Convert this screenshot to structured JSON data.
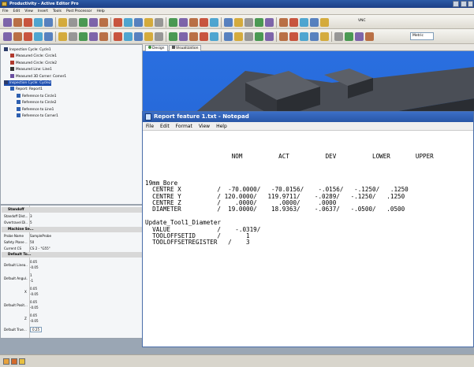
{
  "app": {
    "title": "Productivity - Active Editor Pro"
  },
  "menu": [
    "File",
    "Edit",
    "View",
    "Insert",
    "Tools",
    "Post Processor",
    "Help"
  ],
  "toolbar": {
    "dropdown_label": "Metric",
    "small_label": "VNC"
  },
  "tree": {
    "items": [
      {
        "label": "Inspection Cycle: Cycle1",
        "indent": 0,
        "selected": false,
        "icon_color": "#2c3c6a"
      },
      {
        "label": "Measured Circle: Circle1",
        "indent": 1,
        "selected": false,
        "icon_color": "#b03a2e"
      },
      {
        "label": "Measured Circle: Circle2",
        "indent": 1,
        "selected": false,
        "icon_color": "#b03a2e"
      },
      {
        "label": "Measured Line: Line1",
        "indent": 1,
        "selected": false,
        "icon_color": "#333333"
      },
      {
        "label": "Measured 3D Corner: Corner1",
        "indent": 1,
        "selected": false,
        "icon_color": "#6a4ea0"
      },
      {
        "label": "Inspection Cycle: Cycle2",
        "indent": 0,
        "selected": true,
        "icon_color": "#2c3c6a"
      },
      {
        "label": "Report: Report1",
        "indent": 1,
        "selected": false,
        "icon_color": "#2d5fb0"
      },
      {
        "label": "Reference to Circle1",
        "indent": 2,
        "selected": false,
        "icon_color": "#2d5fb0"
      },
      {
        "label": "Reference to Circle2",
        "indent": 2,
        "selected": false,
        "icon_color": "#2d5fb0"
      },
      {
        "label": "Reference to Line1",
        "indent": 2,
        "selected": false,
        "icon_color": "#2d5fb0"
      },
      {
        "label": "Reference to Corner1",
        "indent": 2,
        "selected": false,
        "icon_color": "#2d5fb0"
      }
    ]
  },
  "props": {
    "groups": [
      {
        "title": "Standoff",
        "rows": [
          {
            "label": "Standoff Dist...",
            "value": "3"
          },
          {
            "label": "Overtravel Di...",
            "value": "5"
          }
        ]
      },
      {
        "title": "Machine Se...",
        "rows": [
          {
            "label": "Probe Name",
            "value": "SampleProbe"
          },
          {
            "label": "Safety Plane ...",
            "value": "50"
          },
          {
            "label": "Current CS",
            "value": "CS 2 - \"G55\""
          }
        ]
      },
      {
        "title": "Default To...",
        "rows": []
      }
    ],
    "tolerance_rows": [
      {
        "label": "Default Linea...",
        "sub": "",
        "values": [
          "0.05",
          "-0.05"
        ]
      },
      {
        "label": "Default Angul...",
        "sub": "",
        "values": [
          "1",
          "-1"
        ]
      },
      {
        "label": "",
        "sub": "X",
        "values": [
          "0.05",
          "-0.05"
        ]
      },
      {
        "label": "Default Posit...Y",
        "sub": "",
        "values": [
          "0.05",
          "-0.05"
        ]
      },
      {
        "label": "",
        "sub": "Z",
        "values": [
          "0.05",
          "-0.05"
        ]
      }
    ],
    "last_row": {
      "label": "Default True...",
      "value": "0.25"
    }
  },
  "design_tabs": [
    "Design",
    "Visualization"
  ],
  "notepad": {
    "title": "Report feature 1.txt - Notepad",
    "menu": [
      "File",
      "Edit",
      "Format",
      "View",
      "Help"
    ],
    "lines": [
      "",
      "",
      "",
      "                        NOM          ACT          DEV          LOWER       UPPER",
      "",
      "",
      "",
      "19mm_Bore",
      "  CENTRE X          /  -70.0000/   -70.0156/    -.0156/   -.1250/   .1250",
      "  CENTRE Y          / 120.0000/   119.9711/    -.0289/   -.1250/   .1250",
      "  CENTRE Z          /    .0000/      .0000/     .0000",
      "  DIAMETER          /  19.0000/    18.9363/    -.0637/   -.0500/   .0500",
      "",
      "Update_Tool1_Diameter",
      "  VALUE             /    -.0319/",
      "  TOOLOFFSETID      /       1",
      "  TOOLOFFSETREGISTER   /    3"
    ]
  },
  "colors": {
    "viewport_blue": "#1f63d8",
    "selection": "#1e4fb0",
    "title_blue": "#2856a6"
  }
}
